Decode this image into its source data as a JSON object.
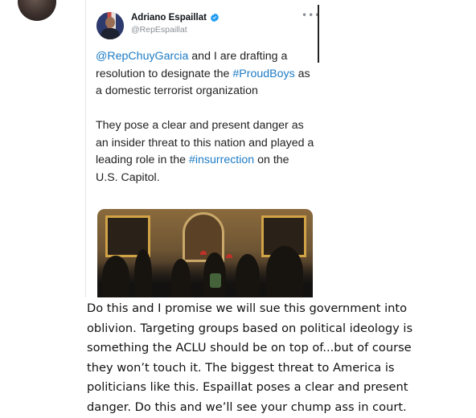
{
  "tweet": {
    "author_name": "Adriano Espaillat",
    "handle": "@RepEspaillat",
    "verified": true,
    "more_icon": "more-options-icon",
    "paragraph1": {
      "mention": "@RepChuyGarcia",
      "text_a": " and I are drafting a resolution to designate the ",
      "hashtag": "#ProudBoys",
      "text_b": " as a domestic terrorist organization"
    },
    "paragraph2": {
      "text_a": "They pose a clear and present danger as an insider threat to this nation and played a leading role in the ",
      "hashtag": "#insurrection",
      "text_b": " on the U.S. Capitol."
    }
  },
  "caption": {
    "lines": [
      "Do this and I promise we will sue this government into",
      "oblivion. Targeting groups based on political ideology is",
      "something the ACLU should be on top of...but of course",
      "they won’t touch it. The biggest threat to America is",
      "politicians like this.  Espaillat poses a clear and present",
      "danger. Do this and we’ll see your chump ass in court."
    ]
  },
  "colors": {
    "link": "#1d7bc4",
    "verified": "#1d9bf0",
    "text": "#222222",
    "handle": "#8a8f95"
  }
}
